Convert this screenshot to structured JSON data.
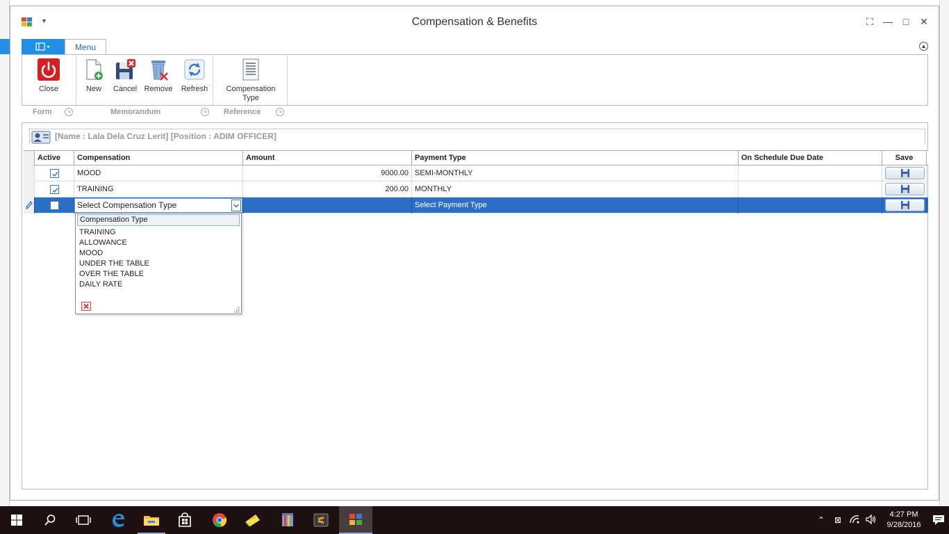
{
  "window": {
    "title": "Compensation & Benefits"
  },
  "ribbon": {
    "tab_menu": "Menu",
    "buttons": {
      "close": "Close",
      "new": "New",
      "cancel": "Cancel",
      "remove": "Remove",
      "refresh": "Refresh",
      "compensation_type_line1": "Compensation",
      "compensation_type_line2": "Type"
    },
    "groups": {
      "form": "Form",
      "memorandum": "Memorandum",
      "reference": "Reference"
    }
  },
  "employee": {
    "info": "[Name : Lala Dela Cruz Lerit]  [Position : ADIM OFFICER]"
  },
  "grid": {
    "columns": {
      "active": "Active",
      "compensation": "Compensation",
      "amount": "Amount",
      "payment_type": "Payment Type",
      "due_date": "On Schedule Due Date",
      "save": "Save"
    },
    "rows": [
      {
        "active": true,
        "compensation": "MOOD",
        "amount": "9000.00",
        "payment_type": "SEMI-MONTHLY",
        "due_date": ""
      },
      {
        "active": true,
        "compensation": "TRAINING",
        "amount": "200.00",
        "payment_type": "MONTHLY",
        "due_date": ""
      }
    ],
    "new_row": {
      "active": false,
      "compensation_placeholder": "Select Compensation Type",
      "payment_type_placeholder": "Select Payment Type"
    }
  },
  "dropdown": {
    "header": "Compensation Type",
    "items": [
      "TRAINING",
      "ALLOWANCE",
      "MOOD",
      "UNDER THE TABLE",
      "OVER THE TABLE",
      "DAILY RATE"
    ]
  },
  "taskbar": {
    "time": "4:27 PM",
    "date": "9/28/2016"
  },
  "colors": {
    "accent": "#1e90e6",
    "selection": "#2d6fc7",
    "close_red": "#d42020"
  }
}
